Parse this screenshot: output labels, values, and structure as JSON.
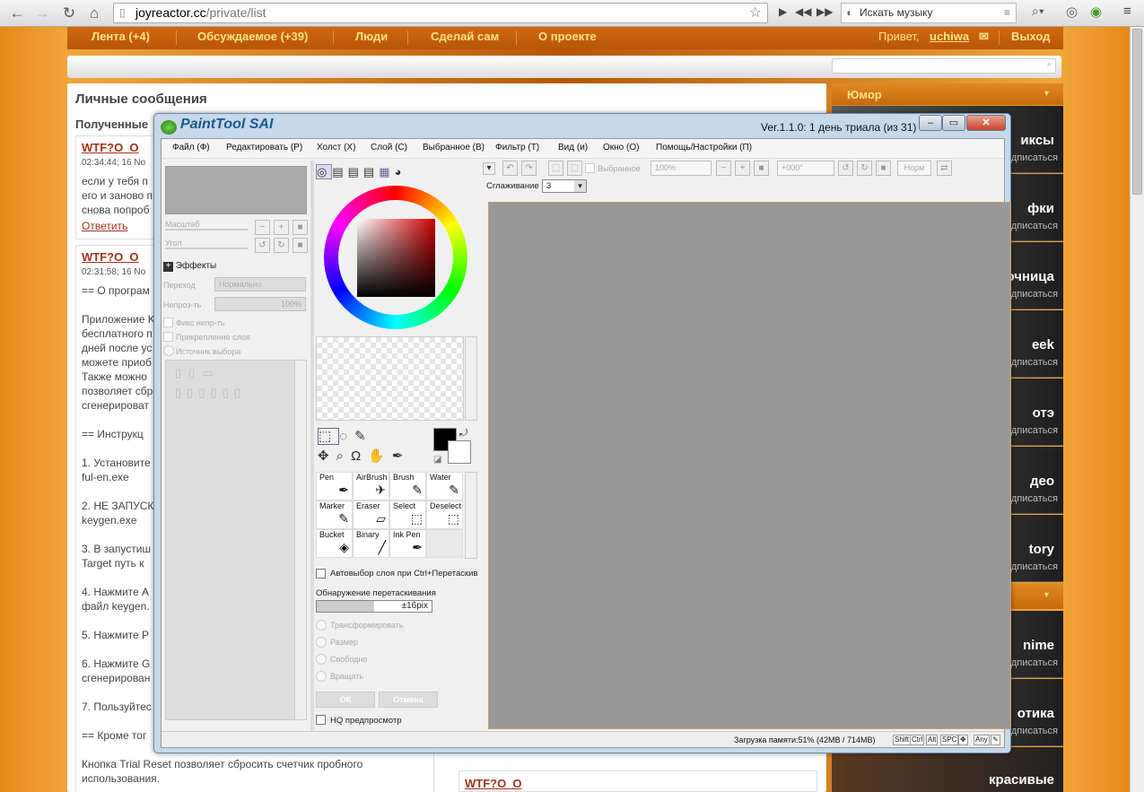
{
  "browser": {
    "url_host": "joyreactor.cc",
    "url_path": "/private/list",
    "music_search_placeholder": "Искать музыку"
  },
  "site": {
    "nav": [
      "Лента (+4)",
      "Обсуждаемое (+39)",
      "Люди",
      "Сделай сам",
      "О проекте"
    ],
    "greeting": "Привет,",
    "username": "uchiwa",
    "logout": "Выход",
    "page_title": "Личные сообщения",
    "received_label": "Полученные",
    "messages": [
      {
        "title": "WTF?O_O",
        "time": "02:34:44; 16 No",
        "body": [
          "если у тебя п",
          "его и заново п",
          "снова попроб"
        ],
        "reply": "Ответить"
      },
      {
        "title": "WTF?O_O",
        "time": "02:31:58; 16 No",
        "body": [
          "== О програм",
          "",
          "Приложение K",
          "бесплатного п",
          "дней после ус",
          "можете приоб",
          "Также можно",
          "позволяет сбр",
          "сгенерироват",
          "",
          "== Инструкц",
          "",
          "1. Установите",
          "ful-en.exe",
          "",
          "2. НЕ ЗАПУСК",
          "keygen.exe",
          "",
          "3. В запустиш",
          "Target путь к",
          "",
          "4. Нажмите A",
          "файл keygen.",
          "",
          "5. Нажмите P",
          "",
          "6. Нажмите G",
          "сгенерирован",
          "",
          "7. Пользуйтес",
          "",
          "== Кроме тог",
          "",
          "Кнопка Trial Reset позволяет сбросить счетчик пробного",
          "использования."
        ]
      }
    ],
    "bottom_wtf": "WTF?O_O",
    "sidebar_header": "Юмор",
    "sidebar_items": [
      {
        "label": "иксы",
        "sub": "дписаться"
      },
      {
        "label": "фки",
        "sub": "дписаться"
      },
      {
        "label": "очница",
        "sub": "дписаться"
      },
      {
        "label": "eek",
        "sub": "дписаться"
      },
      {
        "label": "отэ",
        "sub": "дписаться"
      },
      {
        "label": "део",
        "sub": "дписаться"
      },
      {
        "label": "tory",
        "sub": "дписаться"
      },
      {
        "label": "nime",
        "sub": "дписаться"
      },
      {
        "label": "отика",
        "sub": "дписаться"
      },
      {
        "label": "красивые картинки",
        "sub": ""
      }
    ]
  },
  "sai": {
    "title": "PaintTool SAI",
    "version": "Ver.1.1.0: 1 день триала (из 31)",
    "menu": [
      "Файл (Ф)",
      "Редактировать (Р)",
      "Холст (Х)",
      "Слой (С)",
      "Выбранное (В)",
      "Фильтр (Т)",
      "Вид (и)",
      "Окно (О)",
      "Помощь/Настройки (П)"
    ],
    "nav_panel": {
      "scale": "Масштаб",
      "angle": "Угол"
    },
    "effects": "Эффекты",
    "layer": {
      "blend_label": "Переход",
      "blend_value": "Нормально",
      "opacity_label": "Непроз-ть",
      "opacity_value": "100%",
      "fix_opacity": "Фикс непр-ть",
      "clip": "Прикрепление слоя",
      "sel_source": "Источник выбора"
    },
    "toolbar": {
      "selected": "Выбранное",
      "zoom": "100%",
      "angle": "+000°",
      "mode": "Норм",
      "smoothing_label": "Сглаживание",
      "smoothing_value": "3"
    },
    "tools": [
      {
        "name": "Pen",
        "icon": "✒"
      },
      {
        "name": "AirBrush",
        "icon": "✈"
      },
      {
        "name": "Brush",
        "icon": "✎"
      },
      {
        "name": "Water",
        "icon": "✎"
      },
      {
        "name": "Marker",
        "icon": "✎"
      },
      {
        "name": "Eraser",
        "icon": "▱"
      },
      {
        "name": "Select",
        "icon": "⬚"
      },
      {
        "name": "Deselect",
        "icon": "⬚"
      },
      {
        "name": "Bucket",
        "icon": "◈"
      },
      {
        "name": "Binary",
        "icon": "╱"
      },
      {
        "name": "Ink Pen",
        "icon": "✒"
      }
    ],
    "tool_options": {
      "auto_select": "Автовыбор слоя при Ctrl+Перетаскив",
      "drag_detect": "Обнаружение перетаскивания",
      "drag_value": "±16pix",
      "transform": "Трансформировать",
      "size": "Размер",
      "free": "Свободно",
      "rotate": "Вращать",
      "ok": "ОК",
      "cancel": "Отмена",
      "hq_preview": "HQ предпросмотр"
    },
    "status": {
      "memory": "Загрузка памяти:51% (42MB / 714MB)",
      "keys": [
        "Shift",
        "Ctrl",
        "Alt",
        "SPC",
        "Any"
      ]
    }
  },
  "colors": {
    "accent": "#e8891a",
    "link": "#a0331a",
    "nav_text": "#ffe08a",
    "canvas": "#999999"
  }
}
